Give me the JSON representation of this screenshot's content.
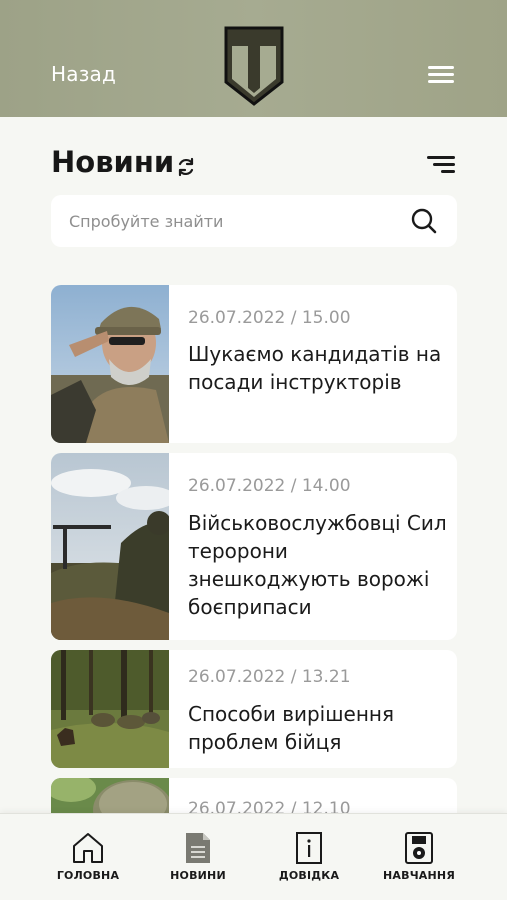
{
  "header": {
    "back_label": "Назад"
  },
  "page": {
    "title": "Новини"
  },
  "search": {
    "placeholder": "Спробуйте знайти",
    "value": ""
  },
  "news": [
    {
      "date": "26.07.2022",
      "time": "15.00",
      "meta": "26.07.2022  /  15.00",
      "title": "Шукаємо кандидатів на посади інструкторів"
    },
    {
      "date": "26.07.2022",
      "time": "14.00",
      "meta": "26.07.2022  /  14.00",
      "title": "Військовослужбовці Сил теророни знешкоджують ворожі боєприпаси"
    },
    {
      "date": "26.07.2022",
      "time": "13.21",
      "meta": "26.07.2022  /  13.21",
      "title": "Способи вирішення проблем бійця"
    },
    {
      "date": "26.07.2022",
      "time": "12.10",
      "meta": "26.07.2022  /  12.10",
      "title": ""
    }
  ],
  "bottom_nav": {
    "items": [
      {
        "label": "ГОЛОВНА",
        "icon": "home-icon"
      },
      {
        "label": "НОВИНИ",
        "icon": "document-icon",
        "active": true
      },
      {
        "label": "ДОВІДКА",
        "icon": "info-icon"
      },
      {
        "label": "НАВЧАННЯ",
        "icon": "media-icon"
      }
    ]
  },
  "colors": {
    "header_bg": "#a3a88d",
    "page_bg": "#f6f7f3",
    "card_bg": "#ffffff",
    "text_primary": "#1b1b1b",
    "text_muted": "#9a9a9a",
    "logo_fill": "#3a3a2e"
  }
}
